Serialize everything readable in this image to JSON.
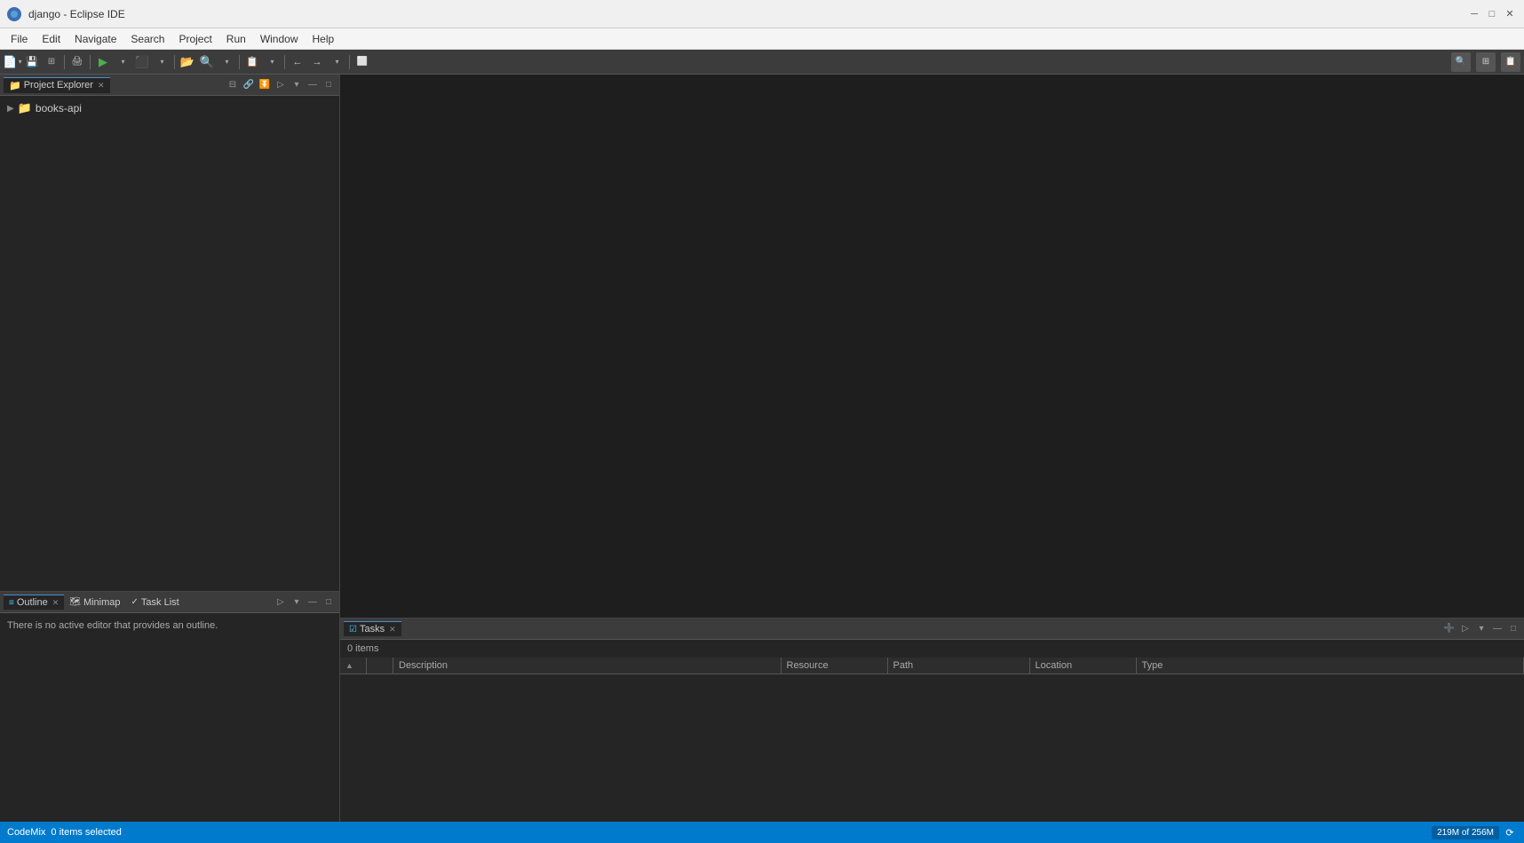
{
  "titleBar": {
    "title": "django - Eclipse IDE",
    "minimizeLabel": "─",
    "maximizeLabel": "□",
    "closeLabel": "✕"
  },
  "menuBar": {
    "items": [
      "File",
      "Edit",
      "Navigate",
      "Search",
      "Project",
      "Run",
      "Window",
      "Help"
    ]
  },
  "toolbar": {
    "searchLabel": "Search"
  },
  "projectExplorer": {
    "tabLabel": "Project Explorer",
    "project": {
      "name": "books-api"
    }
  },
  "bottomLeft": {
    "tabs": [
      {
        "label": "Outline",
        "active": true
      },
      {
        "label": "Minimap",
        "active": false
      },
      {
        "label": "Task List",
        "active": false
      }
    ],
    "outlineMessage": "There is no active editor that provides an outline."
  },
  "tasksPanel": {
    "tabLabel": "Tasks",
    "count": "0 items",
    "columns": [
      "",
      "",
      "Description",
      "Resource",
      "Path",
      "Location",
      "Type"
    ]
  },
  "statusBar": {
    "codemix": "CodeMix",
    "itemsSelected": "0 items selected",
    "memory": "219M of 256M"
  }
}
